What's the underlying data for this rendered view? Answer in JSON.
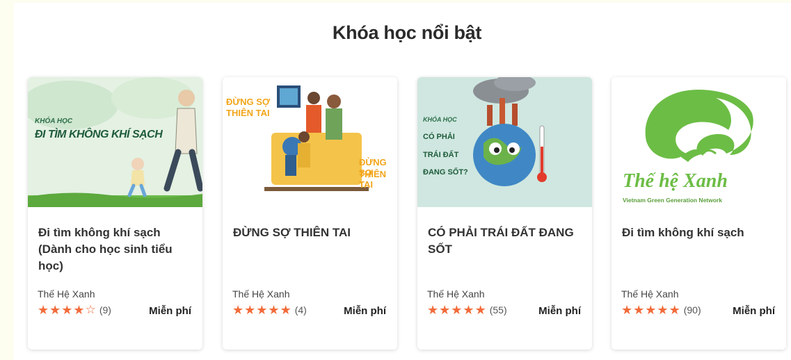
{
  "section": {
    "title": "Khóa học nổi bật"
  },
  "courses": [
    {
      "title": "Đi tìm không khí sạch (Dành cho học sinh tiểu học)",
      "author": "Thế Hệ Xanh",
      "rating": 4,
      "rating_count": "(9)",
      "price": "Miễn phí",
      "thumb_lines": [
        "KHÓA HỌC",
        "ĐI TÌM KHÔNG KHÍ SẠCH"
      ]
    },
    {
      "title": "ĐỪNG SỢ THIÊN TAI",
      "author": "Thế Hệ Xanh",
      "rating": 5,
      "rating_count": "(4)",
      "price": "Miễn phí",
      "thumb_lines": [
        "ĐỪNG SỢ",
        "THIÊN TAI",
        "ĐỪNG SỢ",
        "THIÊN TAI"
      ]
    },
    {
      "title": "CÓ PHẢI TRÁI ĐẤT ĐANG SỐT",
      "author": "Thế Hệ Xanh",
      "rating": 5,
      "rating_count": "(55)",
      "price": "Miễn phí",
      "thumb_lines": [
        "KHÓA HỌC",
        "CÓ PHẢI",
        "TRÁI ĐẤT",
        "ĐANG SỐT?"
      ]
    },
    {
      "title": "Đi tìm không khí sạch",
      "author": "Thế Hệ Xanh",
      "rating": 5,
      "rating_count": "(90)",
      "price": "Miễn phí",
      "thumb_lines": [
        "Thế hệ Xanh",
        "Vietnam Green Generation Network"
      ]
    }
  ],
  "colors": {
    "star": "#f26b3a",
    "logo_green": "#6cbd45",
    "page_bg": "#fdfdf0"
  },
  "icons": {
    "star_full": "★",
    "star_empty": "☆"
  }
}
